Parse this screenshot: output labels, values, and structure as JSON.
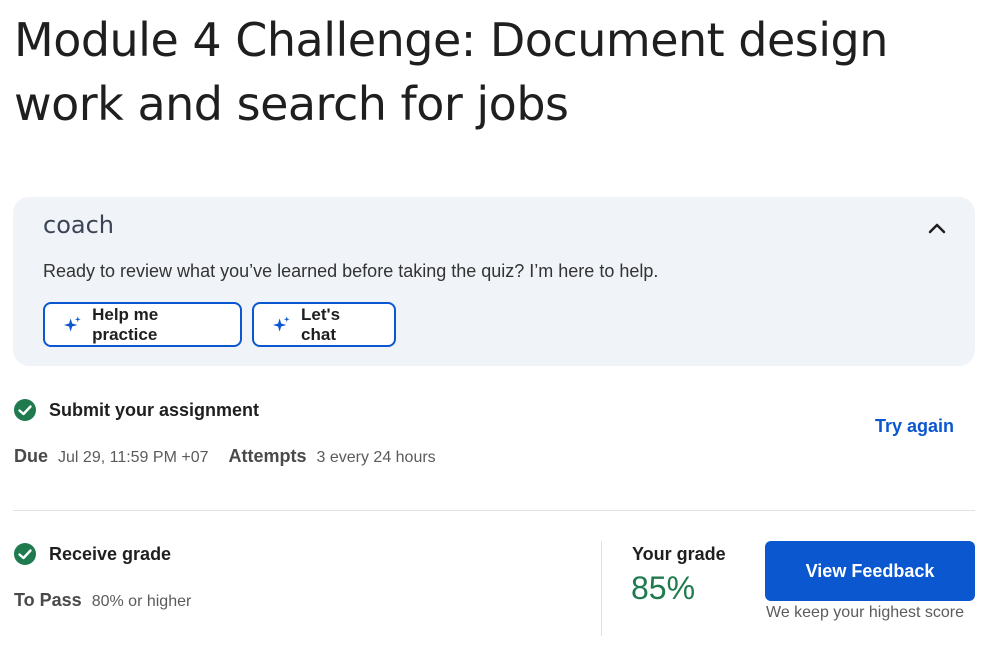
{
  "page": {
    "title": "Module 4 Challenge: Document design work and search for jobs"
  },
  "coach": {
    "brand": "coach",
    "message": "Ready to review what you’ve learned before taking the quiz? I’m here to help.",
    "buttons": {
      "practice": "Help me practice",
      "chat": "Let's chat"
    }
  },
  "assignment": {
    "title": "Submit your assignment",
    "due_label": "Due",
    "due_value": "Jul 29, 11:59 PM +07",
    "attempts_label": "Attempts",
    "attempts_value": "3 every 24 hours",
    "try_again": "Try again"
  },
  "grade": {
    "title": "Receive grade",
    "to_pass_label": "To Pass",
    "to_pass_value": "80% or higher",
    "your_grade_label": "Your grade",
    "your_grade_value": "85%",
    "view_feedback": "View Feedback",
    "keep_score": "We keep your highest score"
  },
  "colors": {
    "accent": "#0b57d0",
    "success": "#1f7a4d",
    "coach_bg": "#f0f3f8"
  },
  "icons": {
    "collapse": "chevron-up-icon",
    "sparkle": "sparkle-icon",
    "check": "check-circle-icon"
  }
}
